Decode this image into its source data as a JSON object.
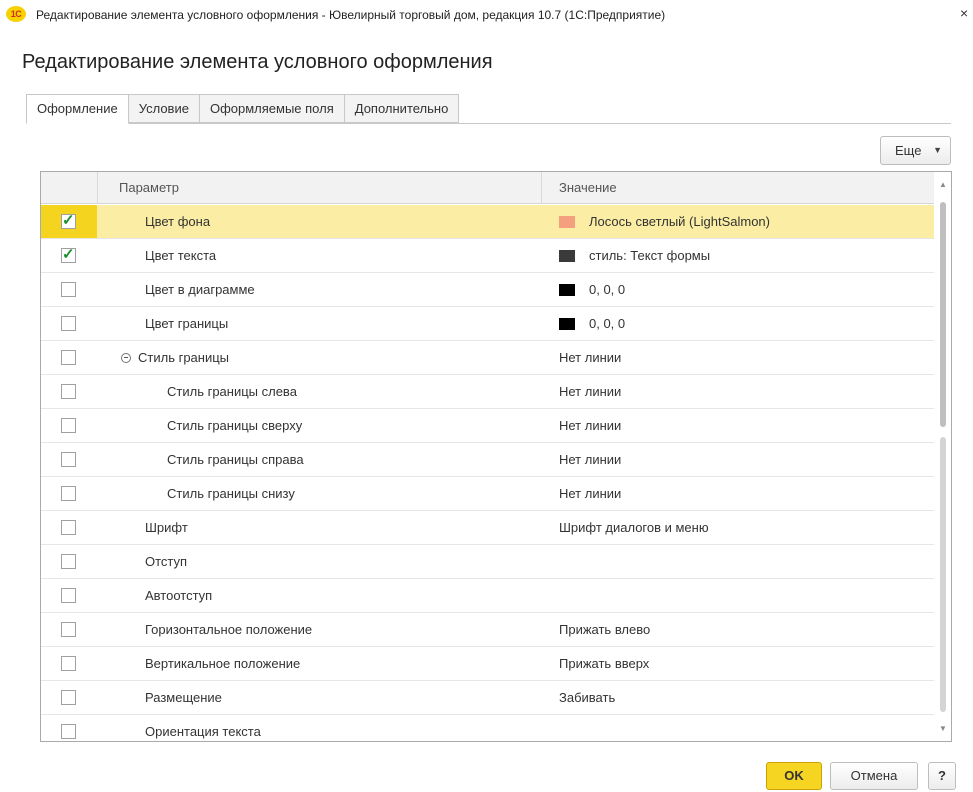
{
  "window": {
    "app_icon": "1C",
    "title": "Редактирование элемента условного оформления - Ювелирный торговый дом, редакция 10.7  (1С:Предприятие)",
    "close_label": "×"
  },
  "page_title": "Редактирование элемента условного оформления",
  "tabs": [
    {
      "label": "Оформление",
      "active": true
    },
    {
      "label": "Условие",
      "active": false
    },
    {
      "label": "Оформляемые поля",
      "active": false
    },
    {
      "label": "Дополнительно",
      "active": false
    }
  ],
  "toolbar": {
    "more_label": "Еще"
  },
  "grid": {
    "columns": {
      "parameter": "Параметр",
      "value": "Значение"
    },
    "rows": [
      {
        "checked": true,
        "param": "Цвет фона",
        "value": "Лосось светлый (LightSalmon)",
        "swatch": "#f4a07e",
        "selected": true
      },
      {
        "checked": true,
        "param": "Цвет текста",
        "value": "стиль: Текст формы",
        "swatch": "#3a3a3a"
      },
      {
        "checked": false,
        "param": "Цвет в диаграмме",
        "value": "0, 0, 0",
        "swatch": "#000000"
      },
      {
        "checked": false,
        "param": "Цвет границы",
        "value": "0, 0, 0",
        "swatch": "#000000"
      },
      {
        "checked": false,
        "param": "Стиль границы",
        "value": "Нет линии",
        "group": true
      },
      {
        "checked": false,
        "param": "Стиль границы слева",
        "value": "Нет линии",
        "child": true
      },
      {
        "checked": false,
        "param": "Стиль границы сверху",
        "value": "Нет линии",
        "child": true
      },
      {
        "checked": false,
        "param": "Стиль границы справа",
        "value": "Нет линии",
        "child": true
      },
      {
        "checked": false,
        "param": "Стиль границы снизу",
        "value": "Нет линии",
        "child": true
      },
      {
        "checked": false,
        "param": "Шрифт",
        "value": "Шрифт диалогов и меню"
      },
      {
        "checked": false,
        "param": "Отступ",
        "value": ""
      },
      {
        "checked": false,
        "param": "Автоотступ",
        "value": ""
      },
      {
        "checked": false,
        "param": "Горизонтальное положение",
        "value": "Прижать влево"
      },
      {
        "checked": false,
        "param": "Вертикальное положение",
        "value": "Прижать вверх"
      },
      {
        "checked": false,
        "param": "Размещение",
        "value": "Забивать"
      },
      {
        "checked": false,
        "param": "Ориентация текста",
        "value": ""
      }
    ]
  },
  "footer": {
    "ok_label": "OK",
    "cancel_label": "Отмена",
    "help_label": "?"
  },
  "colors": {
    "accent": "#f6d422",
    "selected_row": "#fbeea4",
    "check": "#1b8f2a"
  }
}
